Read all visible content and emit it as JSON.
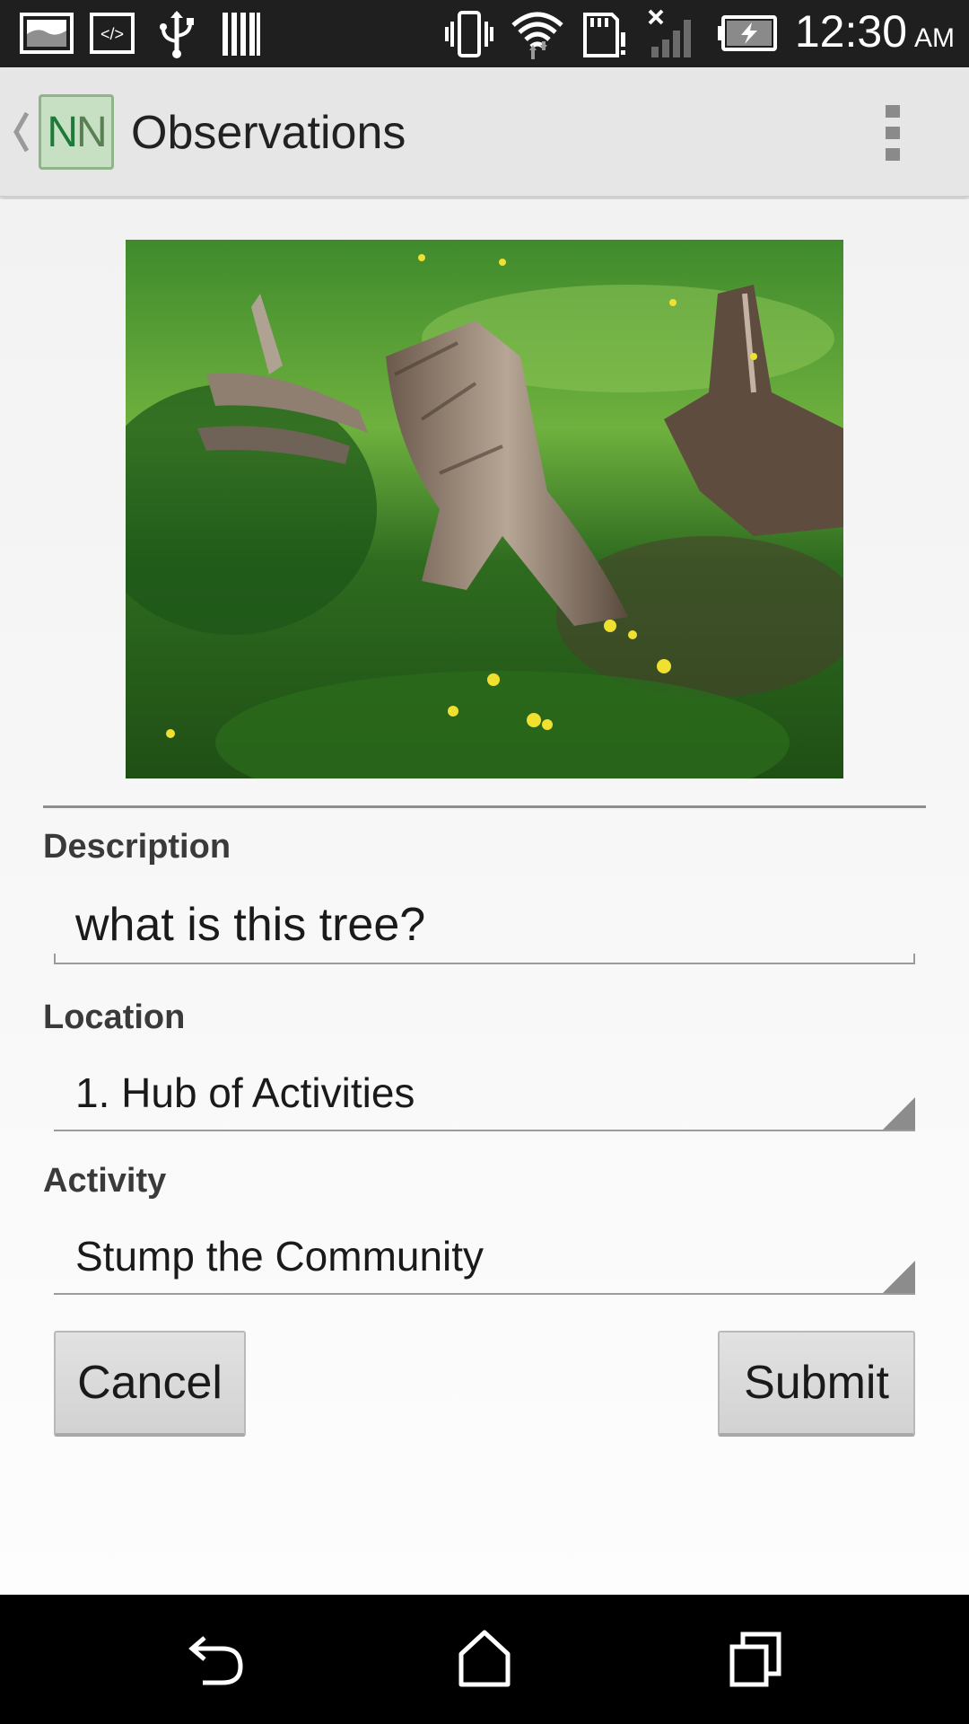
{
  "status_bar": {
    "time": "12:30",
    "ampm": "AM",
    "icons": [
      "image-notification-icon",
      "code-notification-icon",
      "usb-icon",
      "barcode-icon",
      "vibrate-icon",
      "wifi-icon",
      "sd-card-alert-icon",
      "no-signal-icon",
      "battery-charging-icon"
    ]
  },
  "action_bar": {
    "logo_text_1": "N",
    "logo_text_2": "N",
    "title": "Observations"
  },
  "form": {
    "description_label": "Description",
    "description_value": "what is this tree?",
    "location_label": "Location",
    "location_value": "1. Hub of Activities",
    "activity_label": "Activity",
    "activity_value": "Stump the Community",
    "cancel_label": "Cancel",
    "submit_label": "Submit"
  },
  "nav_bar": {
    "icons": [
      "back-icon",
      "home-icon",
      "recent-apps-icon"
    ]
  },
  "colors": {
    "status_bar_bg": "#1f1f1f",
    "action_bar_bg": "#e6e6e6",
    "nav_bar_bg": "#000000",
    "logo_bg": "#c7dfc2",
    "logo_text": "#1d7a3a"
  }
}
